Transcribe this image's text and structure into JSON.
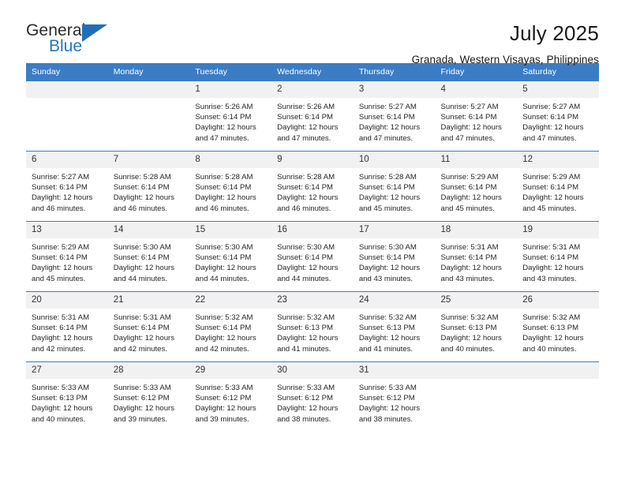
{
  "brand": {
    "name_part1": "General",
    "name_part2": "Blue",
    "accent_color": "#2176c7",
    "triangle_color": "#1f6fb8"
  },
  "header": {
    "title": "July 2025",
    "subtitle": "Granada, Western Visayas, Philippines"
  },
  "calendar": {
    "header_bg": "#3b7dc4",
    "daynum_bg": "#f1f1f1",
    "weekdays": [
      "Sunday",
      "Monday",
      "Tuesday",
      "Wednesday",
      "Thursday",
      "Friday",
      "Saturday"
    ],
    "weeks": [
      [
        {
          "day": "",
          "empty": true,
          "sunrise": "",
          "sunset": "",
          "daylight_line1": "",
          "daylight_line2": ""
        },
        {
          "day": "",
          "empty": true,
          "sunrise": "",
          "sunset": "",
          "daylight_line1": "",
          "daylight_line2": ""
        },
        {
          "day": "1",
          "empty": false,
          "sunrise": "Sunrise: 5:26 AM",
          "sunset": "Sunset: 6:14 PM",
          "daylight_line1": "Daylight: 12 hours",
          "daylight_line2": "and 47 minutes."
        },
        {
          "day": "2",
          "empty": false,
          "sunrise": "Sunrise: 5:26 AM",
          "sunset": "Sunset: 6:14 PM",
          "daylight_line1": "Daylight: 12 hours",
          "daylight_line2": "and 47 minutes."
        },
        {
          "day": "3",
          "empty": false,
          "sunrise": "Sunrise: 5:27 AM",
          "sunset": "Sunset: 6:14 PM",
          "daylight_line1": "Daylight: 12 hours",
          "daylight_line2": "and 47 minutes."
        },
        {
          "day": "4",
          "empty": false,
          "sunrise": "Sunrise: 5:27 AM",
          "sunset": "Sunset: 6:14 PM",
          "daylight_line1": "Daylight: 12 hours",
          "daylight_line2": "and 47 minutes."
        },
        {
          "day": "5",
          "empty": false,
          "sunrise": "Sunrise: 5:27 AM",
          "sunset": "Sunset: 6:14 PM",
          "daylight_line1": "Daylight: 12 hours",
          "daylight_line2": "and 47 minutes."
        }
      ],
      [
        {
          "day": "6",
          "empty": false,
          "sunrise": "Sunrise: 5:27 AM",
          "sunset": "Sunset: 6:14 PM",
          "daylight_line1": "Daylight: 12 hours",
          "daylight_line2": "and 46 minutes."
        },
        {
          "day": "7",
          "empty": false,
          "sunrise": "Sunrise: 5:28 AM",
          "sunset": "Sunset: 6:14 PM",
          "daylight_line1": "Daylight: 12 hours",
          "daylight_line2": "and 46 minutes."
        },
        {
          "day": "8",
          "empty": false,
          "sunrise": "Sunrise: 5:28 AM",
          "sunset": "Sunset: 6:14 PM",
          "daylight_line1": "Daylight: 12 hours",
          "daylight_line2": "and 46 minutes."
        },
        {
          "day": "9",
          "empty": false,
          "sunrise": "Sunrise: 5:28 AM",
          "sunset": "Sunset: 6:14 PM",
          "daylight_line1": "Daylight: 12 hours",
          "daylight_line2": "and 46 minutes."
        },
        {
          "day": "10",
          "empty": false,
          "sunrise": "Sunrise: 5:28 AM",
          "sunset": "Sunset: 6:14 PM",
          "daylight_line1": "Daylight: 12 hours",
          "daylight_line2": "and 45 minutes."
        },
        {
          "day": "11",
          "empty": false,
          "sunrise": "Sunrise: 5:29 AM",
          "sunset": "Sunset: 6:14 PM",
          "daylight_line1": "Daylight: 12 hours",
          "daylight_line2": "and 45 minutes."
        },
        {
          "day": "12",
          "empty": false,
          "sunrise": "Sunrise: 5:29 AM",
          "sunset": "Sunset: 6:14 PM",
          "daylight_line1": "Daylight: 12 hours",
          "daylight_line2": "and 45 minutes."
        }
      ],
      [
        {
          "day": "13",
          "empty": false,
          "sunrise": "Sunrise: 5:29 AM",
          "sunset": "Sunset: 6:14 PM",
          "daylight_line1": "Daylight: 12 hours",
          "daylight_line2": "and 45 minutes."
        },
        {
          "day": "14",
          "empty": false,
          "sunrise": "Sunrise: 5:30 AM",
          "sunset": "Sunset: 6:14 PM",
          "daylight_line1": "Daylight: 12 hours",
          "daylight_line2": "and 44 minutes."
        },
        {
          "day": "15",
          "empty": false,
          "sunrise": "Sunrise: 5:30 AM",
          "sunset": "Sunset: 6:14 PM",
          "daylight_line1": "Daylight: 12 hours",
          "daylight_line2": "and 44 minutes."
        },
        {
          "day": "16",
          "empty": false,
          "sunrise": "Sunrise: 5:30 AM",
          "sunset": "Sunset: 6:14 PM",
          "daylight_line1": "Daylight: 12 hours",
          "daylight_line2": "and 44 minutes."
        },
        {
          "day": "17",
          "empty": false,
          "sunrise": "Sunrise: 5:30 AM",
          "sunset": "Sunset: 6:14 PM",
          "daylight_line1": "Daylight: 12 hours",
          "daylight_line2": "and 43 minutes."
        },
        {
          "day": "18",
          "empty": false,
          "sunrise": "Sunrise: 5:31 AM",
          "sunset": "Sunset: 6:14 PM",
          "daylight_line1": "Daylight: 12 hours",
          "daylight_line2": "and 43 minutes."
        },
        {
          "day": "19",
          "empty": false,
          "sunrise": "Sunrise: 5:31 AM",
          "sunset": "Sunset: 6:14 PM",
          "daylight_line1": "Daylight: 12 hours",
          "daylight_line2": "and 43 minutes."
        }
      ],
      [
        {
          "day": "20",
          "empty": false,
          "sunrise": "Sunrise: 5:31 AM",
          "sunset": "Sunset: 6:14 PM",
          "daylight_line1": "Daylight: 12 hours",
          "daylight_line2": "and 42 minutes."
        },
        {
          "day": "21",
          "empty": false,
          "sunrise": "Sunrise: 5:31 AM",
          "sunset": "Sunset: 6:14 PM",
          "daylight_line1": "Daylight: 12 hours",
          "daylight_line2": "and 42 minutes."
        },
        {
          "day": "22",
          "empty": false,
          "sunrise": "Sunrise: 5:32 AM",
          "sunset": "Sunset: 6:14 PM",
          "daylight_line1": "Daylight: 12 hours",
          "daylight_line2": "and 42 minutes."
        },
        {
          "day": "23",
          "empty": false,
          "sunrise": "Sunrise: 5:32 AM",
          "sunset": "Sunset: 6:13 PM",
          "daylight_line1": "Daylight: 12 hours",
          "daylight_line2": "and 41 minutes."
        },
        {
          "day": "24",
          "empty": false,
          "sunrise": "Sunrise: 5:32 AM",
          "sunset": "Sunset: 6:13 PM",
          "daylight_line1": "Daylight: 12 hours",
          "daylight_line2": "and 41 minutes."
        },
        {
          "day": "25",
          "empty": false,
          "sunrise": "Sunrise: 5:32 AM",
          "sunset": "Sunset: 6:13 PM",
          "daylight_line1": "Daylight: 12 hours",
          "daylight_line2": "and 40 minutes."
        },
        {
          "day": "26",
          "empty": false,
          "sunrise": "Sunrise: 5:32 AM",
          "sunset": "Sunset: 6:13 PM",
          "daylight_line1": "Daylight: 12 hours",
          "daylight_line2": "and 40 minutes."
        }
      ],
      [
        {
          "day": "27",
          "empty": false,
          "sunrise": "Sunrise: 5:33 AM",
          "sunset": "Sunset: 6:13 PM",
          "daylight_line1": "Daylight: 12 hours",
          "daylight_line2": "and 40 minutes."
        },
        {
          "day": "28",
          "empty": false,
          "sunrise": "Sunrise: 5:33 AM",
          "sunset": "Sunset: 6:12 PM",
          "daylight_line1": "Daylight: 12 hours",
          "daylight_line2": "and 39 minutes."
        },
        {
          "day": "29",
          "empty": false,
          "sunrise": "Sunrise: 5:33 AM",
          "sunset": "Sunset: 6:12 PM",
          "daylight_line1": "Daylight: 12 hours",
          "daylight_line2": "and 39 minutes."
        },
        {
          "day": "30",
          "empty": false,
          "sunrise": "Sunrise: 5:33 AM",
          "sunset": "Sunset: 6:12 PM",
          "daylight_line1": "Daylight: 12 hours",
          "daylight_line2": "and 38 minutes."
        },
        {
          "day": "31",
          "empty": false,
          "sunrise": "Sunrise: 5:33 AM",
          "sunset": "Sunset: 6:12 PM",
          "daylight_line1": "Daylight: 12 hours",
          "daylight_line2": "and 38 minutes."
        },
        {
          "day": "",
          "empty": true,
          "sunrise": "",
          "sunset": "",
          "daylight_line1": "",
          "daylight_line2": ""
        },
        {
          "day": "",
          "empty": true,
          "sunrise": "",
          "sunset": "",
          "daylight_line1": "",
          "daylight_line2": ""
        }
      ]
    ]
  }
}
